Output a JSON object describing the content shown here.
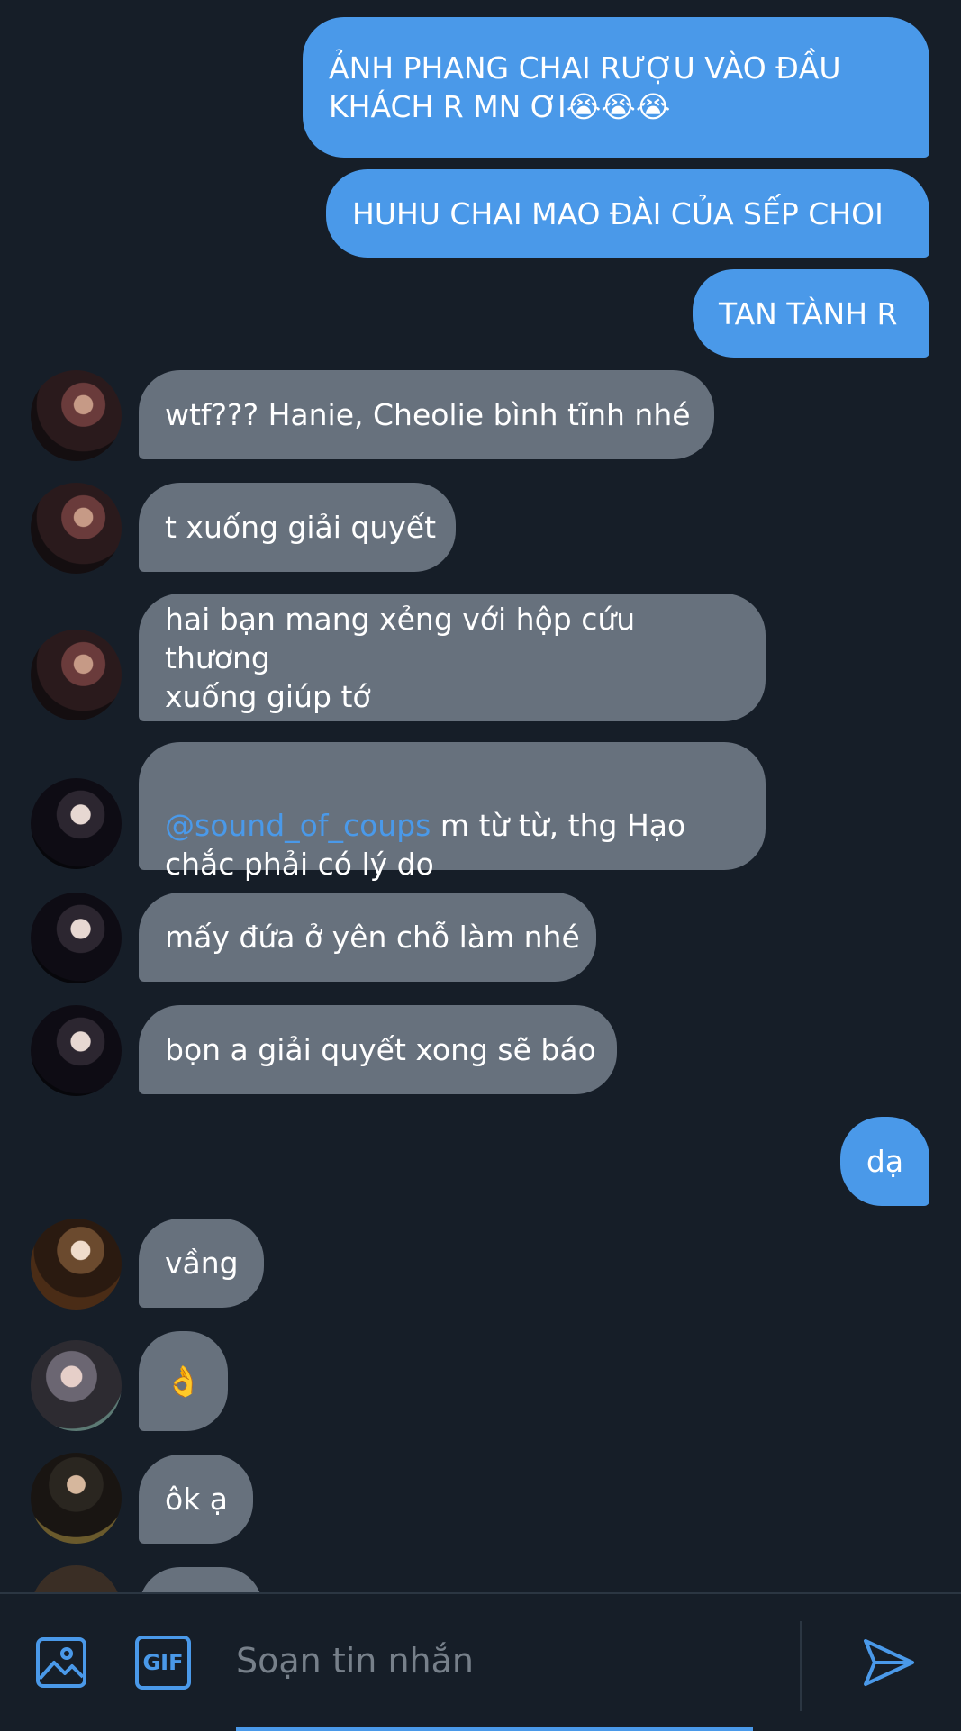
{
  "messages": [
    {
      "dir": "out",
      "text": "ẢNH PHANG CHAI RƯỢU VÀO ĐẦU\nKHÁCH R MN ƠI😭😭😭"
    },
    {
      "dir": "out",
      "text": "HUHU CHAI MAO ĐÀI CỦA SẾP CHOI"
    },
    {
      "dir": "out",
      "text": "TAN TÀNH R"
    },
    {
      "dir": "in",
      "avatar": "avatar-red-hair",
      "text": "wtf??? Hanie, Cheolie bình tĩnh nhé"
    },
    {
      "dir": "in",
      "avatar": "avatar-red-hair",
      "text": "t xuống giải quyết"
    },
    {
      "dir": "in",
      "avatar": "avatar-red-hair",
      "text": "hai bạn mang xẻng với hộp cứu thương\nxuống giúp tớ"
    },
    {
      "dir": "in",
      "avatar": "avatar-dark-hair",
      "mention": "@sound_of_coups",
      "text": " m từ từ, thg Hạo\nchắc phải có lý do"
    },
    {
      "dir": "in",
      "avatar": "avatar-dark-hair",
      "text": "mấy đứa ở yên chỗ làm nhé"
    },
    {
      "dir": "in",
      "avatar": "avatar-dark-hair",
      "text": "bọn a giải quyết xong sẽ báo"
    },
    {
      "dir": "out",
      "text": "dạ"
    },
    {
      "dir": "in",
      "avatar": "avatar-frame",
      "text": "vầng"
    },
    {
      "dir": "in",
      "avatar": "avatar-posing",
      "text": "👌"
    },
    {
      "dir": "in",
      "avatar": "avatar-chair",
      "text": "ôk ạ"
    }
  ],
  "composer": {
    "placeholder": "Soạn tin nhắn",
    "image_icon": "image-icon",
    "gif_label": "GIF",
    "send_icon": "send-icon"
  },
  "colors": {
    "background": "#161e28",
    "outgoing_bubble": "#4a99e9",
    "incoming_bubble": "#67717d",
    "mention": "#4a99e9"
  }
}
